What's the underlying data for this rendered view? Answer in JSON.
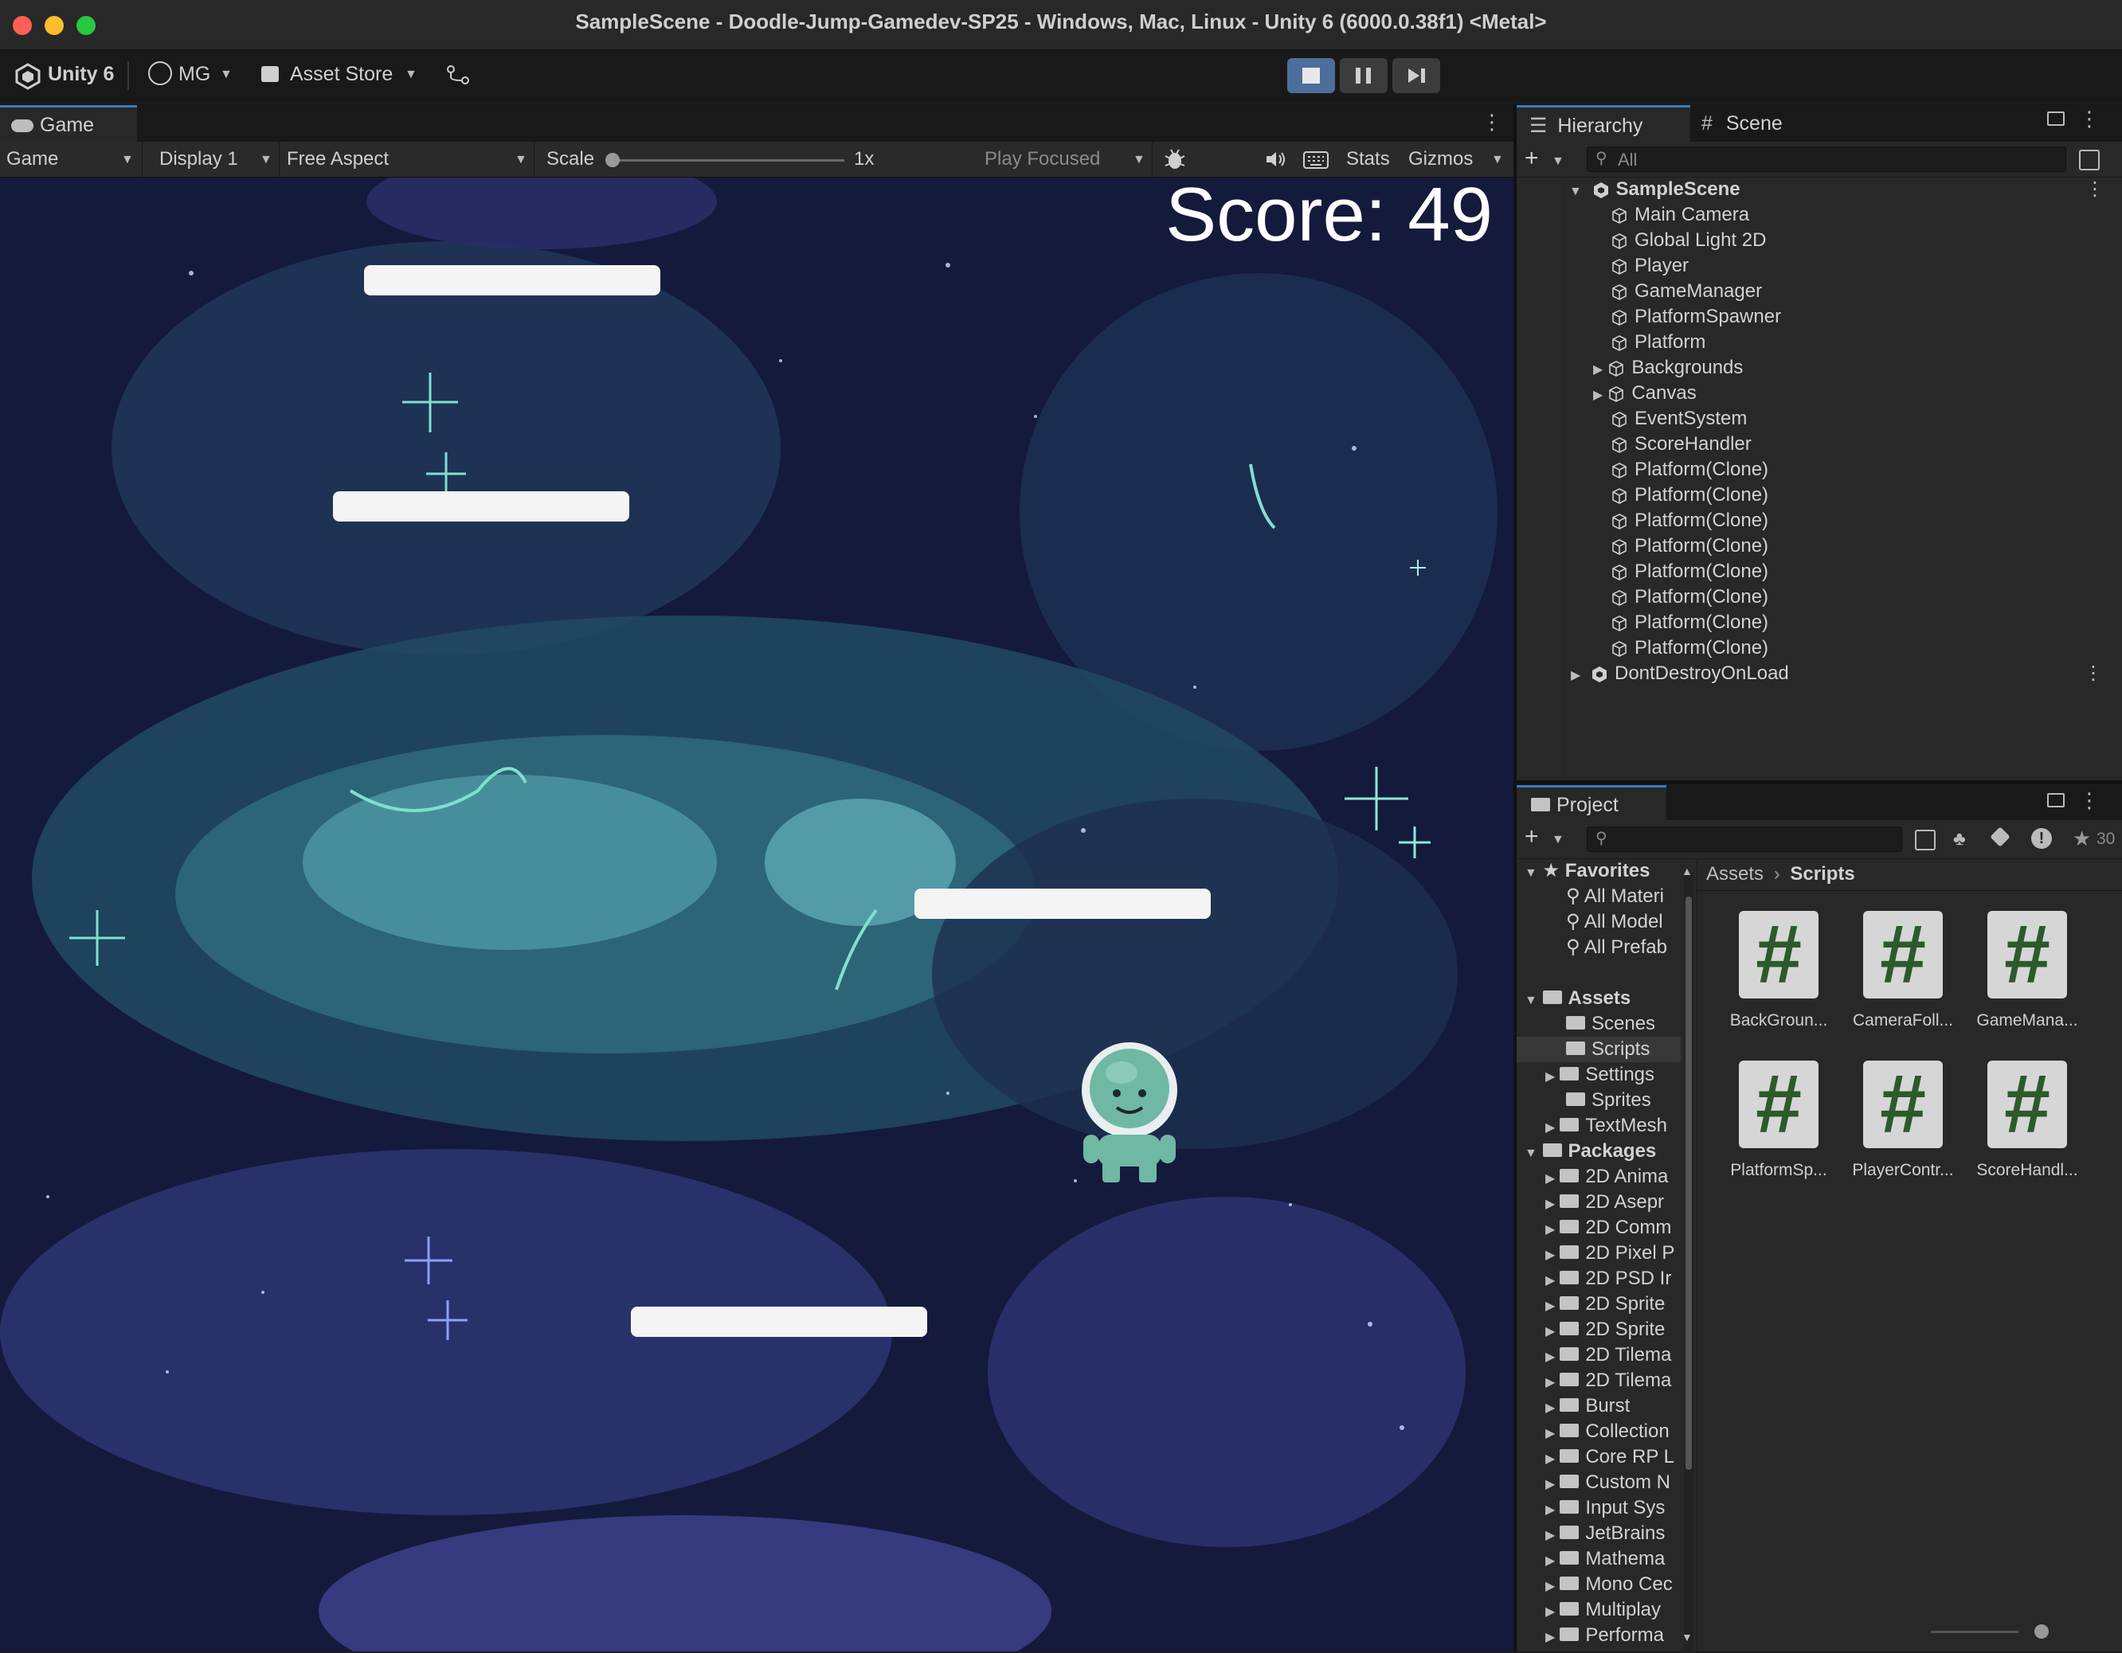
{
  "window": {
    "title": "SampleScene - Doodle-Jump-Gamedev-SP25 - Windows, Mac, Linux - Unity 6 (6000.0.38f1) <Metal>",
    "traffic_colors": [
      "#ff5f57",
      "#febc2e",
      "#28c840"
    ]
  },
  "toolbar": {
    "unity_label": "Unity 6",
    "account_label": "MG",
    "asset_store_label": "Asset Store",
    "play_accent": "#4c6e9a"
  },
  "game": {
    "tab_label": "Game",
    "mode": "Game",
    "display": "Display 1",
    "aspect": "Free Aspect",
    "scale_label": "Scale",
    "scale_value": "1x",
    "play_focused": "Play Focused",
    "stats": "Stats",
    "gizmos": "Gizmos",
    "score_text": "Score: 49"
  },
  "hierarchy": {
    "tab_label": "Hierarchy",
    "scene_tab_label": "Scene",
    "search_placeholder": "All",
    "scene_root": "SampleScene",
    "items": [
      {
        "label": "Main Camera",
        "expandable": false
      },
      {
        "label": "Global Light 2D",
        "expandable": false
      },
      {
        "label": "Player",
        "expandable": false
      },
      {
        "label": "GameManager",
        "expandable": false
      },
      {
        "label": "PlatformSpawner",
        "expandable": false
      },
      {
        "label": "Platform",
        "expandable": false
      },
      {
        "label": "Backgrounds",
        "expandable": true
      },
      {
        "label": "Canvas",
        "expandable": true
      },
      {
        "label": "EventSystem",
        "expandable": false
      },
      {
        "label": "ScoreHandler",
        "expandable": false
      },
      {
        "label": "Platform(Clone)",
        "expandable": false
      },
      {
        "label": "Platform(Clone)",
        "expandable": false
      },
      {
        "label": "Platform(Clone)",
        "expandable": false
      },
      {
        "label": "Platform(Clone)",
        "expandable": false
      },
      {
        "label": "Platform(Clone)",
        "expandable": false
      },
      {
        "label": "Platform(Clone)",
        "expandable": false
      },
      {
        "label": "Platform(Clone)",
        "expandable": false
      },
      {
        "label": "Platform(Clone)",
        "expandable": false
      }
    ],
    "dont_destroy": "DontDestroyOnLoad"
  },
  "project": {
    "tab_label": "Project",
    "hidden_count": "30",
    "favorites_label": "Favorites",
    "favorites": [
      "All Materi",
      "All Model",
      "All Prefab"
    ],
    "assets_label": "Assets",
    "assets": [
      {
        "label": "Scenes",
        "expandable": false
      },
      {
        "label": "Scripts",
        "expandable": false
      },
      {
        "label": "Settings",
        "expandable": true
      },
      {
        "label": "Sprites",
        "expandable": false
      },
      {
        "label": "TextMesh",
        "expandable": true
      }
    ],
    "packages_label": "Packages",
    "packages": [
      "2D Anima",
      "2D Asepr",
      "2D Comm",
      "2D Pixel P",
      "2D PSD Ir",
      "2D Sprite",
      "2D Sprite",
      "2D Tilema",
      "2D Tilema",
      "Burst",
      "Collection",
      "Core RP L",
      "Custom N",
      "Input Sys",
      "JetBrains",
      "Mathema",
      "Mono Cec",
      "Multiplay",
      "Performa"
    ],
    "breadcrumb_root": "Assets",
    "breadcrumb_current": "Scripts",
    "scripts": [
      "BackGroun...",
      "CameraFoll...",
      "GameMana...",
      "PlatformSp...",
      "PlayerContr...",
      "ScoreHandl..."
    ]
  }
}
